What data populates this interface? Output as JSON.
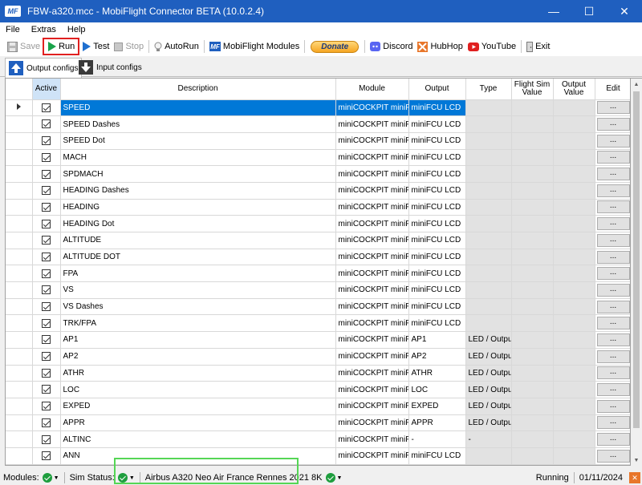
{
  "window": {
    "title": "FBW-a320.mcc - MobiFlight Connector BETA (10.0.2.4)",
    "logo": "MF",
    "minimize": "—",
    "maximize": "☐",
    "close": "✕"
  },
  "menu": [
    "File",
    "Extras",
    "Help"
  ],
  "toolbar": {
    "save": "Save",
    "run": "Run",
    "test": "Test",
    "stop": "Stop",
    "autorun": "AutoRun",
    "modules": "MobiFlight Modules",
    "donate": "Donate",
    "discord": "Discord",
    "hubhop": "HubHop",
    "youtube": "YouTube",
    "exit": "Exit"
  },
  "tabs": {
    "output": "Output configs",
    "input": "Input configs"
  },
  "table": {
    "headers": {
      "active": "Active",
      "description": "Description",
      "module": "Module",
      "output": "Output",
      "type": "Type",
      "fsv_line1": "Flight Sim",
      "fsv_line2": "Value",
      "ov_line1": "Output",
      "ov_line2": "Value",
      "edit": "Edit"
    },
    "edit_label": "...",
    "rows": [
      {
        "description": "SPEED",
        "module": "miniCOCKPIT miniFCU",
        "output": "miniFCU LCD",
        "type": ""
      },
      {
        "description": "SPEED Dashes",
        "module": "miniCOCKPIT miniFCU",
        "output": "miniFCU LCD",
        "type": ""
      },
      {
        "description": "SPEED Dot",
        "module": "miniCOCKPIT miniFCU",
        "output": "miniFCU LCD",
        "type": ""
      },
      {
        "description": "MACH",
        "module": "miniCOCKPIT miniFCU",
        "output": "miniFCU LCD",
        "type": ""
      },
      {
        "description": "SPDMACH",
        "module": "miniCOCKPIT miniFCU",
        "output": "miniFCU LCD",
        "type": ""
      },
      {
        "description": "HEADING Dashes",
        "module": "miniCOCKPIT miniFCU",
        "output": "miniFCU LCD",
        "type": ""
      },
      {
        "description": "HEADING",
        "module": "miniCOCKPIT miniFCU",
        "output": "miniFCU LCD",
        "type": ""
      },
      {
        "description": "HEADING Dot",
        "module": "miniCOCKPIT miniFCU",
        "output": "miniFCU LCD",
        "type": ""
      },
      {
        "description": "ALTITUDE",
        "module": "miniCOCKPIT miniFCU",
        "output": "miniFCU LCD",
        "type": ""
      },
      {
        "description": "ALTITUDE DOT",
        "module": "miniCOCKPIT miniFCU",
        "output": "miniFCU LCD",
        "type": ""
      },
      {
        "description": "FPA",
        "module": "miniCOCKPIT miniFCU",
        "output": "miniFCU LCD",
        "type": ""
      },
      {
        "description": "VS",
        "module": "miniCOCKPIT miniFCU",
        "output": "miniFCU LCD",
        "type": ""
      },
      {
        "description": "VS Dashes",
        "module": "miniCOCKPIT miniFCU",
        "output": "miniFCU LCD",
        "type": ""
      },
      {
        "description": "TRK/FPA",
        "module": "miniCOCKPIT miniFCU",
        "output": "miniFCU LCD",
        "type": ""
      },
      {
        "description": "AP1",
        "module": "miniCOCKPIT miniFCU",
        "output": "AP1",
        "type": "LED / Output"
      },
      {
        "description": "AP2",
        "module": "miniCOCKPIT miniFCU",
        "output": "AP2",
        "type": "LED / Output"
      },
      {
        "description": "ATHR",
        "module": "miniCOCKPIT miniFCU",
        "output": "ATHR",
        "type": "LED / Output"
      },
      {
        "description": "LOC",
        "module": "miniCOCKPIT miniFCU",
        "output": "LOC",
        "type": "LED / Output"
      },
      {
        "description": "EXPED",
        "module": "miniCOCKPIT miniFCU",
        "output": "EXPED",
        "type": "LED / Output"
      },
      {
        "description": "APPR",
        "module": "miniCOCKPIT miniFCU",
        "output": "APPR",
        "type": "LED / Output"
      },
      {
        "description": "ALTINC",
        "module": "miniCOCKPIT miniFCU",
        "output": "-",
        "type": "-"
      },
      {
        "description": "ANN",
        "module": "miniCOCKPIT miniFCU",
        "output": "miniFCU LCD",
        "type": ""
      },
      {
        "description": "",
        "module": "",
        "output": "",
        "type": ""
      }
    ]
  },
  "status": {
    "modules_label": "Modules:",
    "sim_status_label": "Sim Status:",
    "aircraft": "Airbus A320 Neo Air France Rennes 2021 8K",
    "running": "Running",
    "date": "01/11/2024"
  },
  "colors": {
    "titlebar": "#1f5fbf",
    "selection": "#0078d7",
    "run_highlight": "#e02020",
    "sim_highlight": "#55d655",
    "ok_green": "#1e9e3e"
  }
}
